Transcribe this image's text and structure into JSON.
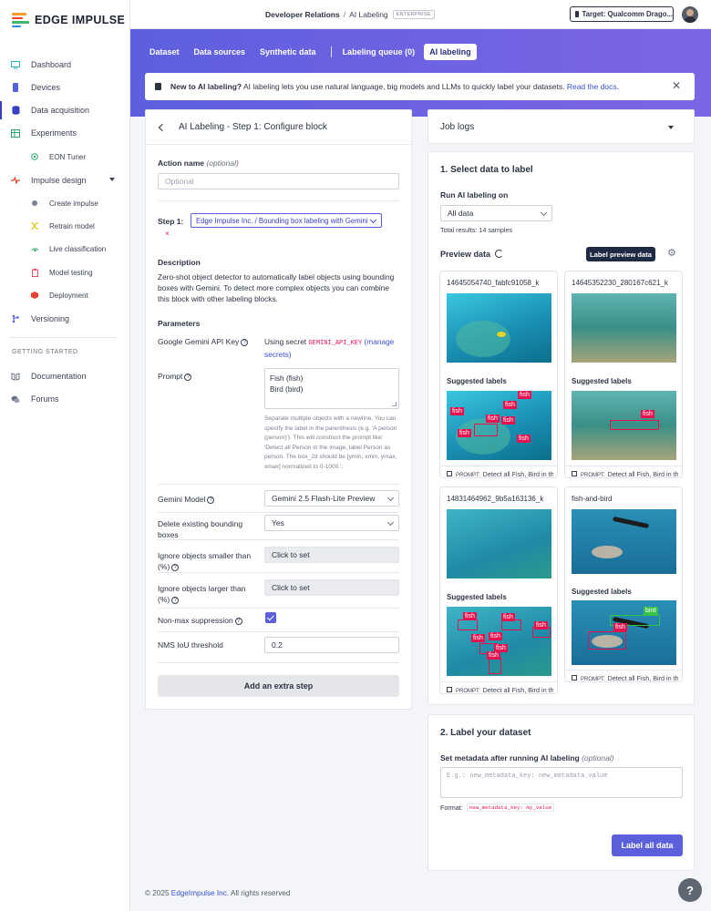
{
  "brand": {
    "name": "EDGE IMPULSE"
  },
  "sidebar": {
    "items": [
      {
        "label": "Dashboard",
        "icon": "monitor-icon"
      },
      {
        "label": "Devices",
        "icon": "device-icon"
      },
      {
        "label": "Data acquisition",
        "icon": "database-icon"
      },
      {
        "label": "Experiments",
        "icon": "table-icon"
      },
      {
        "label": "EON Tuner",
        "icon": "tuner-icon"
      },
      {
        "label": "Impulse design",
        "icon": "pulse-icon"
      },
      {
        "label": "Create impulse",
        "icon": "dot-icon"
      },
      {
        "label": "Retrain model",
        "icon": "shuffle-icon"
      },
      {
        "label": "Live classification",
        "icon": "live-icon"
      },
      {
        "label": "Model testing",
        "icon": "clipboard-icon"
      },
      {
        "label": "Deployment",
        "icon": "box-icon"
      },
      {
        "label": "Versioning",
        "icon": "branch-icon"
      }
    ],
    "section_title": "GETTING STARTED",
    "getting_started": [
      {
        "label": "Documentation",
        "icon": "book-icon"
      },
      {
        "label": "Forums",
        "icon": "chat-icon"
      }
    ]
  },
  "header": {
    "project": "Developer Relations",
    "separator": "/",
    "page": "AI Labeling",
    "badge": "ENTERPRISE",
    "target": "Target: Qualcomm Drago..."
  },
  "tabs": [
    {
      "label": "Dataset"
    },
    {
      "label": "Data sources"
    },
    {
      "label": "Synthetic data"
    },
    {
      "label": "Labeling queue (0)"
    },
    {
      "label": "AI labeling"
    }
  ],
  "notice": {
    "bold": "New to AI labeling?",
    "text": " AI labeling lets you use natural language, big models and LLMs to quickly label your datasets. ",
    "link": "Read the docs",
    "end": "."
  },
  "config": {
    "title": "AI Labeling - Step 1: Configure block",
    "action_name_label": "Action name",
    "action_name_optional": "(optional)",
    "action_name_placeholder": "Optional",
    "step_label": "Step 1:",
    "step_value": "Edge Impulse Inc. / Bounding box labeling with Gemini",
    "description_title": "Description",
    "description": "Zero-shot object detector to automatically label objects using bounding boxes with Gemini. To detect more complex objects you can combine this block with other labeling blocks.",
    "parameters_title": "Parameters",
    "api_key_label": "Google Gemini API Key",
    "api_key_prefix": "Using secret ",
    "api_key_secret": "GEMINI_API_KEY",
    "api_key_manage": "(manage secrets)",
    "prompt_label": "Prompt",
    "prompt_lines": [
      "Fish (fish)",
      "Bird (bird)"
    ],
    "prompt_help": "Separate multiple objects with a newline. You can specify the label in the parenthesis (e.g. 'A person (person)'). This will construct the prompt like: 'Detect all Person in the image, label Person as person. The box_2d should be [ymin, xmin, ymax, xmax] normalized to 0-1000.'.",
    "model_label": "Gemini Model",
    "model_value": "Gemini 2.5 Flash-Lite Preview",
    "delete_label": "Delete existing bounding boxes",
    "delete_value": "Yes",
    "smaller_label": "Ignore objects smaller than (%)",
    "smaller_value": "Click to set",
    "larger_label": "Ignore objects larger than (%)",
    "larger_value": "Click to set",
    "nms_label": "Non-max suppression",
    "nms_checked": true,
    "nms_threshold_label": "NMS IoU threshold",
    "nms_threshold_value": "0.2",
    "add_step": "Add an extra step"
  },
  "job_logs": {
    "title": "Job logs"
  },
  "select_data": {
    "title": "1. Select data to label",
    "run_on_label": "Run AI labeling on",
    "run_on_value": "All data",
    "total": "Total results: 14 samples",
    "preview_title": "Preview data",
    "preview_button": "Label preview data",
    "suggested_label": "Suggested labels",
    "prompt_prefix": "PROMPT:",
    "prompt_text": "Detect all Fish, Bird in the image",
    "samples": [
      {
        "name": "14645054740_fabfc91058_k"
      },
      {
        "name": "14645352230_280167c621_k"
      },
      {
        "name": "14831464962_9b5a163136_k"
      },
      {
        "name": "fish-and-bird"
      }
    ],
    "label_names": {
      "fish": "fish",
      "bird": "bird"
    }
  },
  "label_dataset": {
    "title": "2. Label your dataset",
    "metadata_label": "Set metadata after running AI labeling",
    "metadata_optional": "(optional)",
    "metadata_placeholder": "E.g.: new_metadata_key: new_metadata_value",
    "format_label": "Format:",
    "format_value": "new_metadata_key: my_value",
    "button": "Label all data"
  },
  "footer": {
    "prefix": "© 2025 ",
    "link": "EdgeImpulse Inc.",
    "suffix": " All rights reserved"
  },
  "colors": {
    "primary": "#5b5fd9",
    "accent": "#3b3fbf",
    "label_red": "#e4134f",
    "label_green": "#34c24a"
  }
}
